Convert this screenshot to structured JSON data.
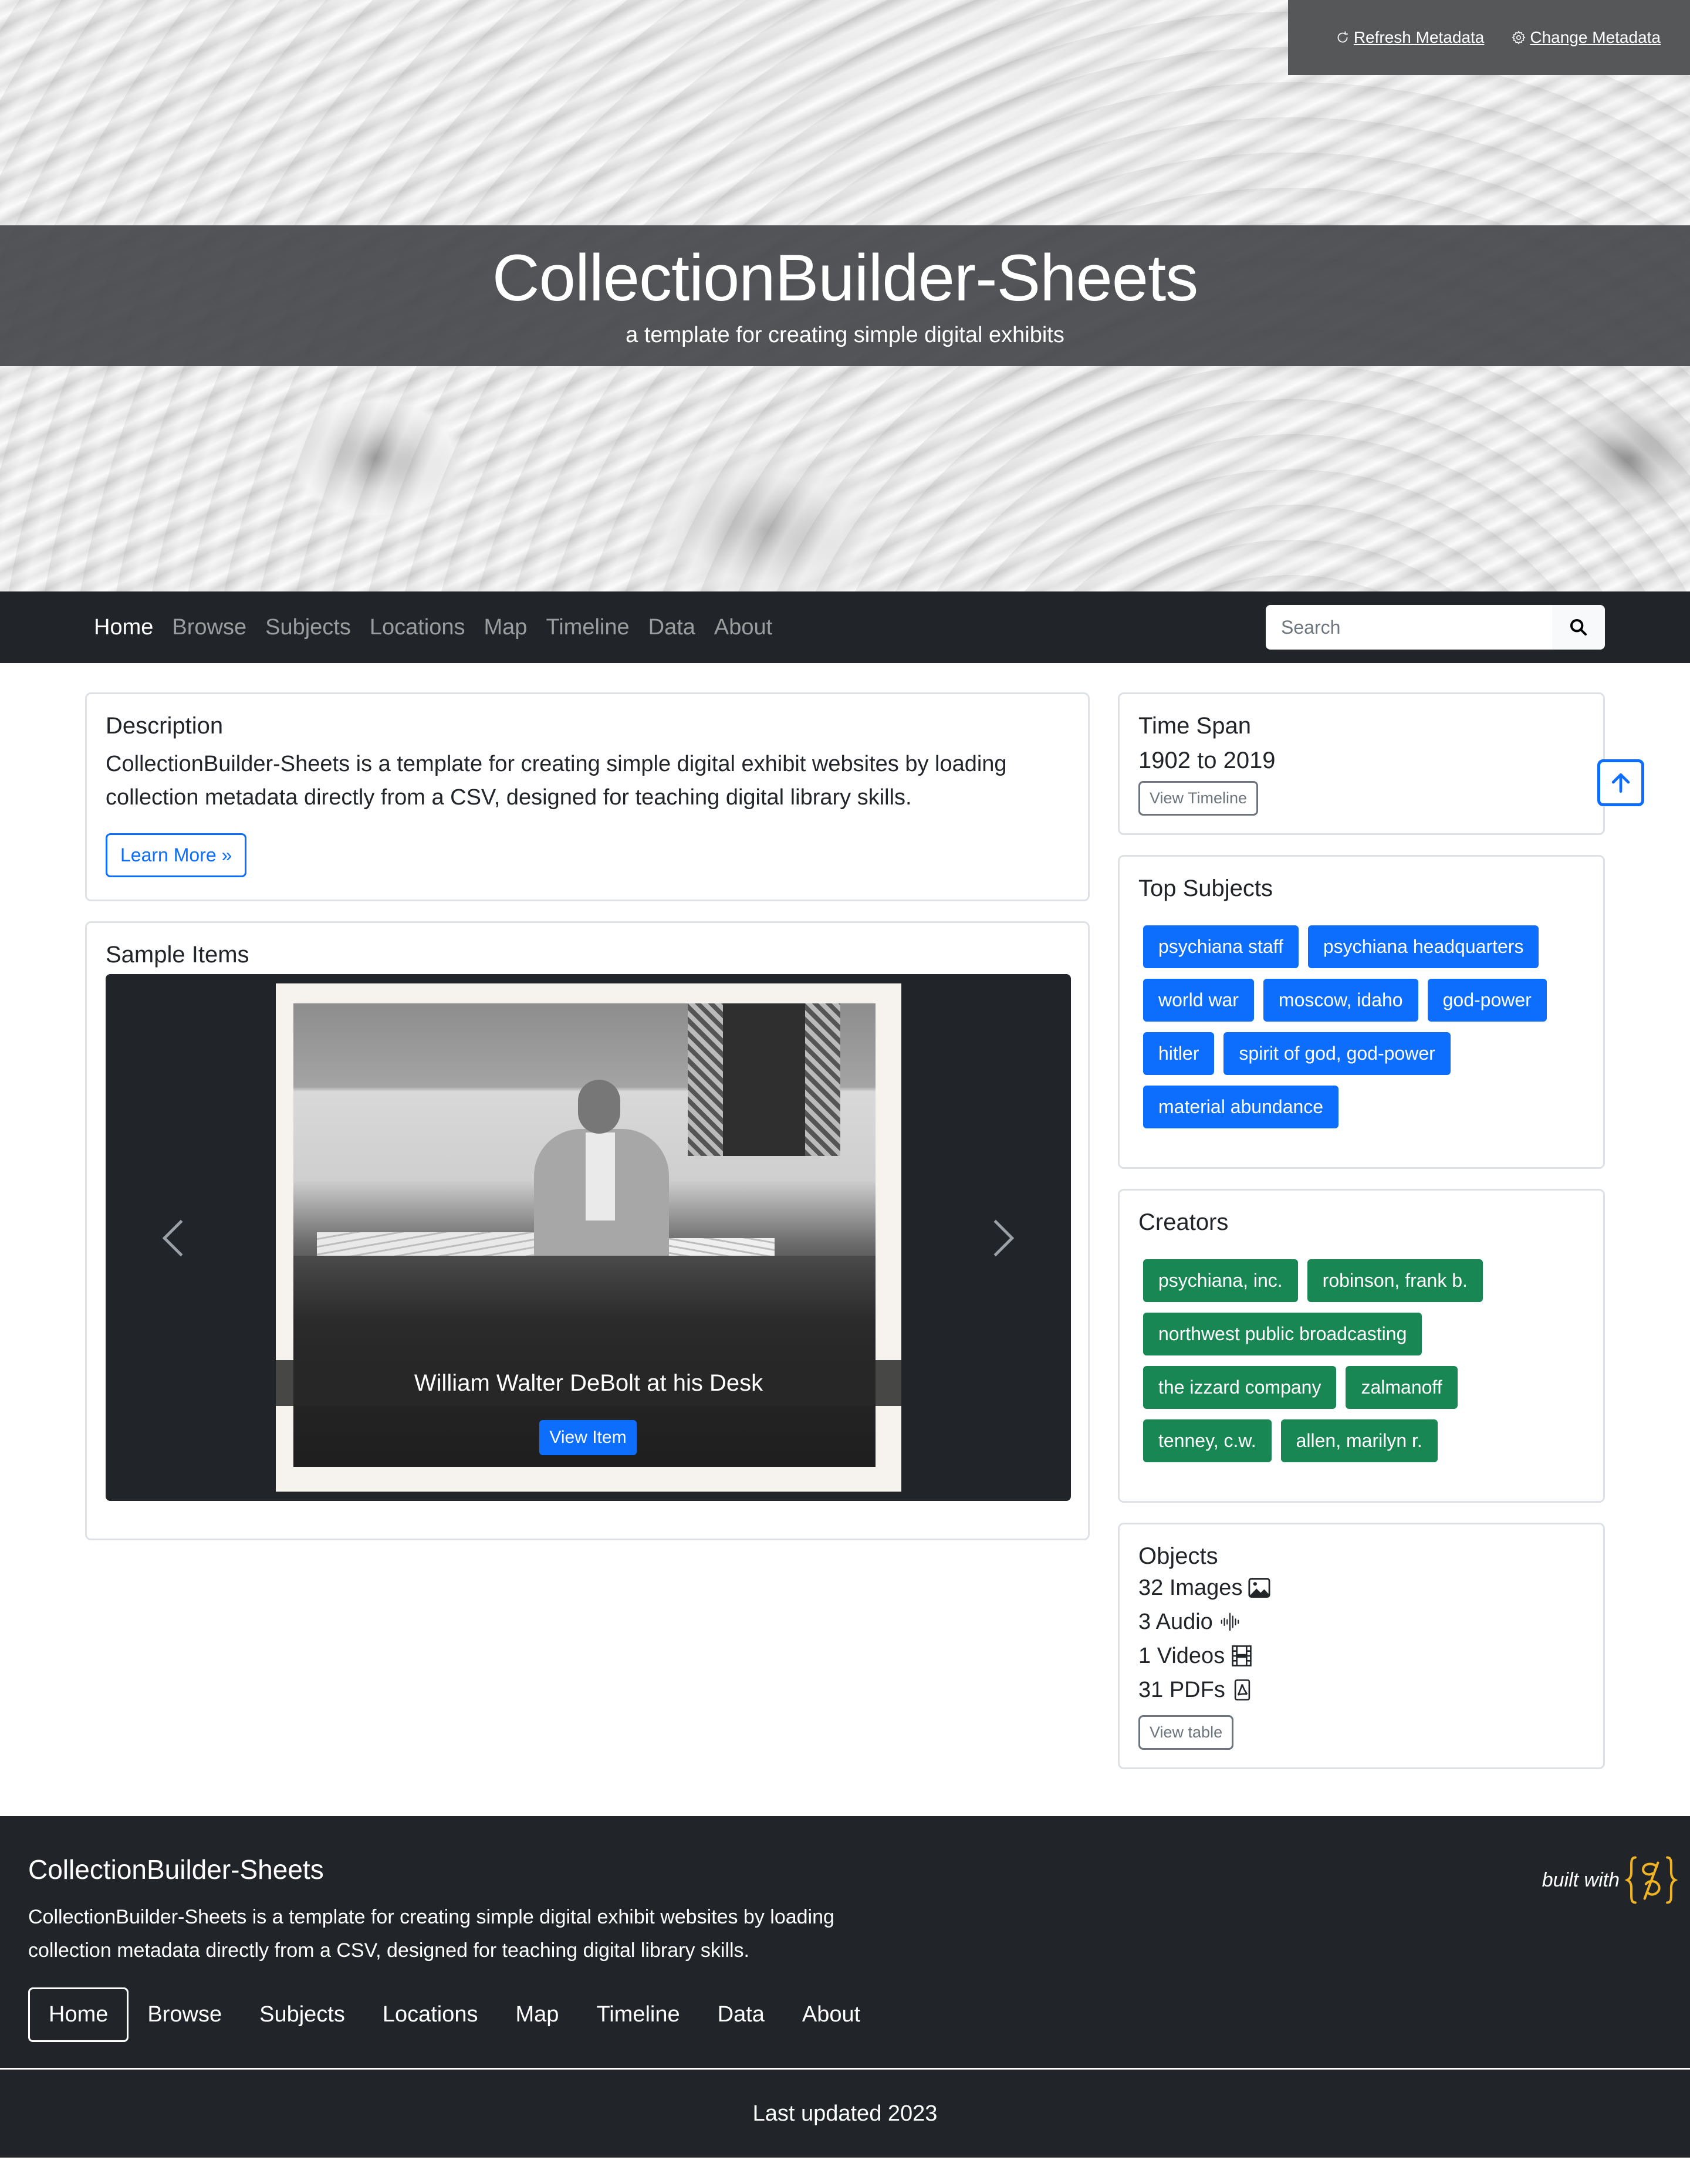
{
  "meta_bar": {
    "refresh_label": "Refresh Metadata",
    "change_label": "Change Metadata"
  },
  "hero": {
    "title": "CollectionBuilder-Sheets",
    "subtitle": "a template for creating simple digital exhibits"
  },
  "navbar": {
    "items": [
      {
        "label": "Home",
        "active": true
      },
      {
        "label": "Browse"
      },
      {
        "label": "Subjects"
      },
      {
        "label": "Locations"
      },
      {
        "label": "Map"
      },
      {
        "label": "Timeline"
      },
      {
        "label": "Data"
      },
      {
        "label": "About"
      }
    ],
    "search": {
      "placeholder": "Search",
      "value": ""
    }
  },
  "description": {
    "title": "Description",
    "text": "CollectionBuilder-Sheets is a template for creating simple digital exhibit websites by loading collection metadata directly from a CSV, designed for teaching digital library skills.",
    "button": "Learn More »"
  },
  "sample_items": {
    "title": "Sample Items",
    "caption": "William Walter DeBolt at his Desk",
    "view_button": "View Item"
  },
  "time_span": {
    "title": "Time Span",
    "value": "1902 to 2019",
    "button": "View Timeline"
  },
  "top_subjects": {
    "title": "Top Subjects",
    "tags": [
      "psychiana staff",
      "psychiana headquarters",
      "world war",
      "moscow, idaho",
      "god-power",
      "hitler",
      "spirit of god, god-power",
      "material abundance"
    ]
  },
  "creators": {
    "title": "Creators",
    "tags": [
      "psychiana, inc.",
      "robinson, frank b.",
      "northwest public broadcasting",
      "the izzard company",
      "zalmanoff",
      "tenney, c.w.",
      "allen, marilyn r."
    ]
  },
  "objects": {
    "title": "Objects",
    "rows": [
      {
        "label": "32 Images",
        "icon": "image-icon"
      },
      {
        "label": "3 Audio",
        "icon": "audio-waveform-icon"
      },
      {
        "label": "1 Videos",
        "icon": "film-icon"
      },
      {
        "label": "31 PDFs",
        "icon": "pdf-file-icon"
      }
    ],
    "button": "View table"
  },
  "footer": {
    "title": "CollectionBuilder-Sheets",
    "description": "CollectionBuilder-Sheets is a template for creating simple digital exhibit websites by loading collection metadata directly from a CSV, designed for teaching digital library skills.",
    "nav": [
      "Home",
      "Browse",
      "Subjects",
      "Locations",
      "Map",
      "Timeline",
      "Data",
      "About"
    ],
    "built_with": "built with",
    "last_updated": "Last updated 2023"
  },
  "colors": {
    "primary": "#0d6efd",
    "success": "#198754",
    "dark": "#212529",
    "logo_accent": "#f0b323"
  }
}
